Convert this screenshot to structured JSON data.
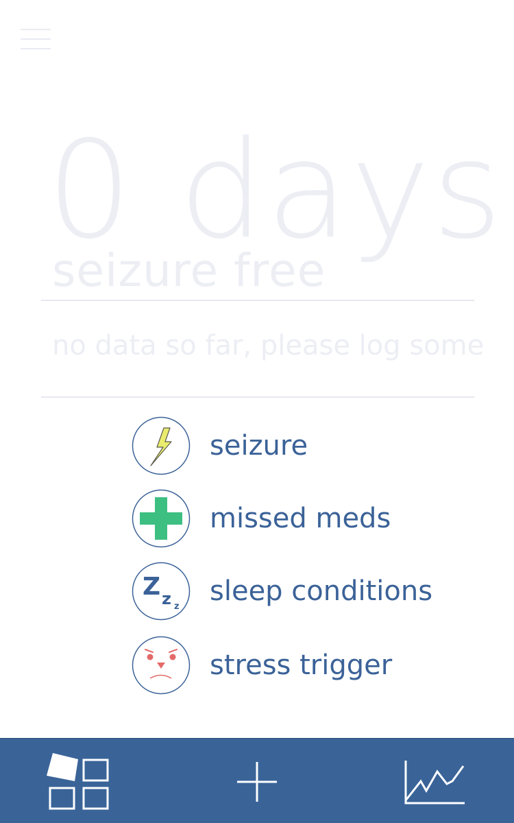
{
  "header": {
    "menu_icon": "hamburger-menu-icon"
  },
  "hero": {
    "count": "0 days",
    "caption": "seizure free"
  },
  "status": {
    "message": "no data so far, please log some"
  },
  "log_actions": [
    {
      "label": "seizure",
      "icon": "lightning-bolt-icon"
    },
    {
      "label": "missed meds",
      "icon": "medical-cross-icon"
    },
    {
      "label": "sleep conditions",
      "icon": "sleep-zzz-icon"
    },
    {
      "label": "stress trigger",
      "icon": "stressed-face-icon"
    }
  ],
  "tabbar": {
    "tabs": [
      {
        "icon": "dashboard-grid-icon"
      },
      {
        "icon": "plus-icon"
      },
      {
        "icon": "line-chart-icon"
      }
    ]
  },
  "colors": {
    "accent_blue": "#3a6498",
    "label_blue": "#3b6298",
    "ghost_text": "#eceef4",
    "bolt_yellow": "#e9ec6e",
    "cross_green": "#3dbf82",
    "stress_red": "#e46a6a"
  }
}
